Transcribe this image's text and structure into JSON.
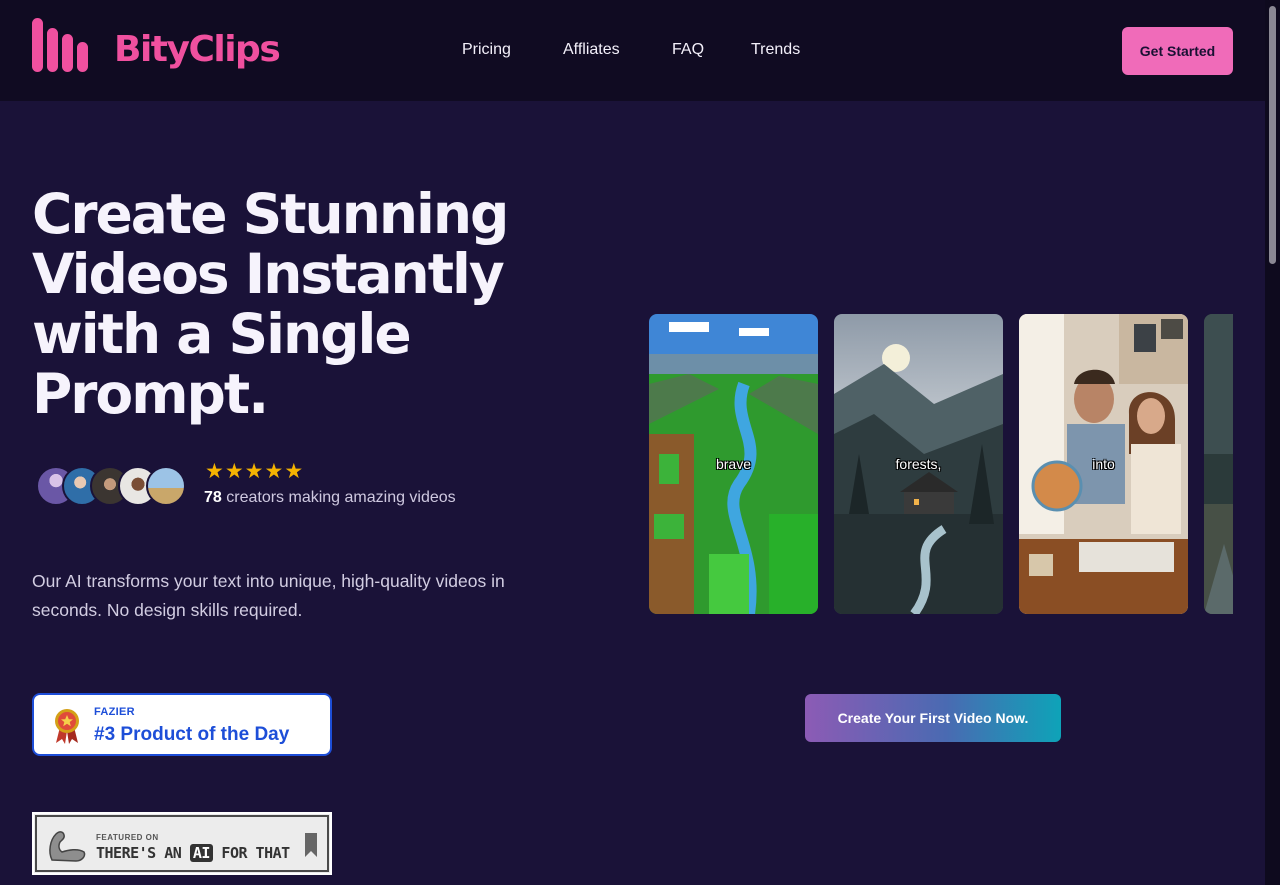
{
  "brand": {
    "name": "BityClips",
    "color": "#f0509f"
  },
  "nav": {
    "items": [
      "Pricing",
      "Affliates",
      "FAQ",
      "Trends"
    ]
  },
  "header": {
    "cta_label": "Get Started"
  },
  "hero": {
    "title": "Create Stunning Videos Instantly with a Single Prompt.",
    "rating_stars": 5,
    "creators_count": "78",
    "creators_text": " creators making amazing videos",
    "description": "Our AI transforms your text into unique, high-quality videos in seconds. No design skills required."
  },
  "badges": {
    "fazier": {
      "label_small": "FAZIER",
      "label_big": "#3 Product of the Day"
    },
    "aiforthat": {
      "label_small": "FEATURED ON",
      "label_prefix": "THERE'S AN ",
      "label_ai": "AI",
      "label_suffix": " FOR THAT"
    }
  },
  "videos": [
    {
      "caption": "brave",
      "scene": "pixel-valley"
    },
    {
      "caption": "forests,",
      "scene": "misty-village"
    },
    {
      "caption": "into",
      "scene": "couple-globe"
    },
    {
      "caption": "",
      "scene": "stormy-road"
    }
  ],
  "cta": {
    "label": "Create Your First Video Now."
  },
  "colors": {
    "background": "#1a1238",
    "header": "#100b22",
    "accent_pink": "#f06bb9",
    "star": "#f5b301"
  }
}
